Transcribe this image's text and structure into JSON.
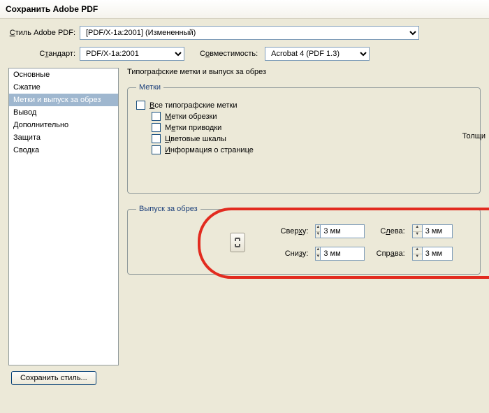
{
  "title": "Сохранить Adobe PDF",
  "styleRow": {
    "label": "Стиль Adobe PDF:",
    "value": "[PDF/X-1a:2001] (Измененный)"
  },
  "standardRow": {
    "label": "Стандарт:",
    "value": "PDF/X-1a:2001"
  },
  "compatRow": {
    "label": "Совместимость:",
    "value": "Acrobat 4 (PDF 1.3)"
  },
  "sidebar": {
    "items": [
      "Основные",
      "Сжатие",
      "Метки и выпуск за обрез",
      "Вывод",
      "Дополнительно",
      "Защита",
      "Сводка"
    ],
    "selectedIndex": 2
  },
  "sectionTitle": "Типографские метки и выпуск за обрез",
  "marks": {
    "legend": "Метки",
    "all": "Все типографские метки",
    "trim": "Метки обрезки",
    "reg": "Метки приводки",
    "color": "Цветовые шкалы",
    "page": "Информация о странице",
    "thicknessLabel": "Толщи"
  },
  "bleed": {
    "legend": "Выпуск за обрез",
    "top": {
      "label": "Сверху:",
      "value": "3 мм"
    },
    "bottom": {
      "label": "Снизу:",
      "value": "3 мм"
    },
    "left": {
      "label": "Слева:",
      "value": "3 мм"
    },
    "right": {
      "label": "Справа:",
      "value": "3 мм"
    },
    "linkTooltip": "link-icon"
  },
  "saveStyle": "Сохранить стиль..."
}
